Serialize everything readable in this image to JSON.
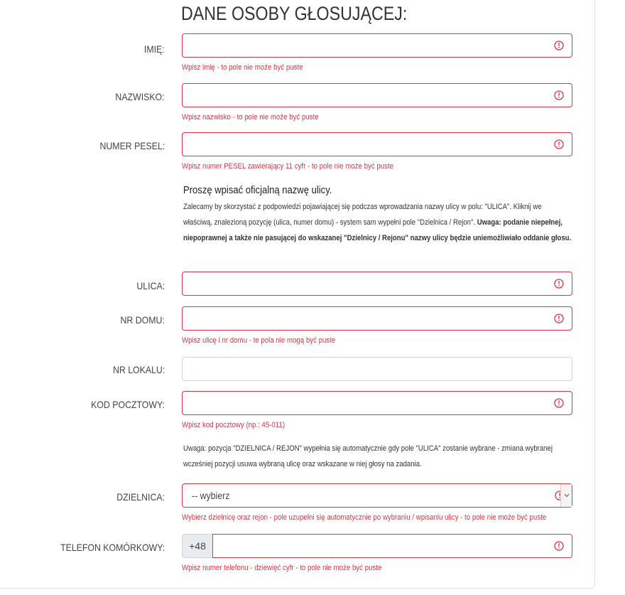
{
  "title": "DANE OSOBY GŁOSUJĄCEJ:",
  "fields": {
    "imie": {
      "label": "IMIĘ:",
      "value": "",
      "error": "Wpisz imię - to pole nie może być puste"
    },
    "nazwisko": {
      "label": "NAZWISKO:",
      "value": "",
      "error": "Wpisz nazwisko - to pole nie może być puste"
    },
    "pesel": {
      "label": "NUMER PESEL:",
      "value": "",
      "error": "Wpisz numer PESEL zawierający 11 cyfr - to pole nie może być puste"
    },
    "ulica": {
      "label": "ULICA:",
      "value": ""
    },
    "nr_domu": {
      "label": "NR DOMU:",
      "value": "",
      "error": "Wpisz ulicę i nr domu - te pola nie mogą być puste"
    },
    "nr_lokalu": {
      "label": "NR LOKALU:",
      "value": ""
    },
    "kod": {
      "label": "KOD POCZTOWY:",
      "value": "",
      "error": "Wpisz kod pocztowy (np.: 45-011)"
    },
    "dzielnica": {
      "label": "DZIELNICA:",
      "selected": "-- wybierz",
      "error": "Wybierz dzielnicę oraz rejon - pole uzupełni się automatycznie po wybraniu / wpisaniu ulicy - to pole nie może być puste"
    },
    "telefon": {
      "label": "TELEFON KOMÓRKOWY:",
      "prefix": "+48",
      "value": "",
      "error": "Wpisz numer telefonu - dziewięć cyfr - to pole nie może być puste"
    }
  },
  "street_note": {
    "heading": "Proszę wpisać oficjalną nazwę ulicy.",
    "body": "Zalecamy by skorzystać z podpowiedzi pojawiającej się podczas wprowadzania nazwy ulicy w polu: \"ULICA\". Kliknij we właściwą, znalezioną pozycję (ulica, numer domu) - system sam wypełni pole \"Dzielnica / Rejon\".",
    "warning_label": "Uwaga:",
    "warning": "podanie niepełnej, niepoprawnej a także nie pasującej do wskazanej \"Dzielnicy / Rejonu\" nazwy ulicy będzie uniemożliwiało oddanie głosu."
  },
  "district_note": "Uwaga: pozycja \"DZIELNICA / REJON\" wypełnia się automatycznie gdy pole \"ULICA\" zostanie wybrane - zmiana wybranej wcześniej pozycji usuwa wybraną ulicę oraz wskazane w niej głosy na zadania.",
  "colors": {
    "error": "#dc3545",
    "text": "#333333",
    "prefix_bg": "#e9ecef"
  }
}
